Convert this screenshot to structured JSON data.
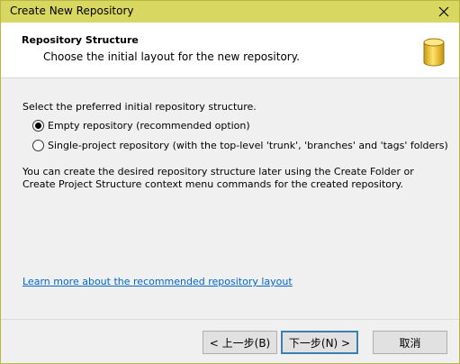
{
  "window": {
    "title": "Create New Repository"
  },
  "header": {
    "title": "Repository Structure",
    "subtitle": "Choose the initial layout for the new repository.",
    "icon": "database-icon"
  },
  "body": {
    "intro": "Select the preferred initial repository structure.",
    "options": [
      {
        "label": "Empty repository (recommended option)",
        "selected": true
      },
      {
        "label": "Single-project repository (with the top-level 'trunk', 'branches' and 'tags' folders)",
        "selected": false
      }
    ],
    "note": "You can create the desired repository structure later using the Create Folder or Create Project Structure context menu commands for the created repository.",
    "link": "Learn more about the recommended repository layout"
  },
  "buttons": {
    "back": "< 上一步(B)",
    "next": "下一步(N) >",
    "cancel": "取消"
  },
  "colors": {
    "titlebar": "#d7d761",
    "link": "#0066cc",
    "default_button_border": "#3c7fb1"
  }
}
